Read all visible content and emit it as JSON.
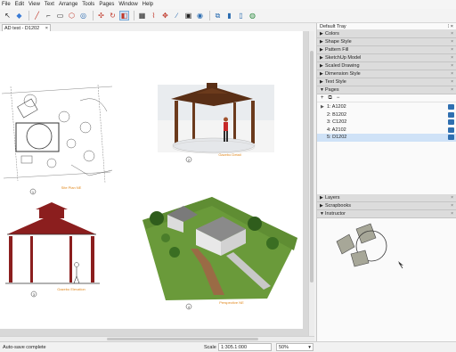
{
  "menu": [
    "File",
    "Edit",
    "View",
    "Text",
    "Arrange",
    "Tools",
    "Pages",
    "Window",
    "Help"
  ],
  "toolbar_icons": [
    "select-icon",
    "eraser-icon",
    "pencil-icon",
    "line-icon",
    "shape-icon",
    "paint-icon",
    "rotate-icon",
    "move-icon",
    "refresh-icon",
    "scrapbook-icon",
    "table-icon",
    "split-icon",
    "join-icon",
    "eyedropper-icon",
    "style-icon",
    "camera-icon",
    "page-add-icon",
    "page-icon",
    "doc-icon",
    "zoom-icon"
  ],
  "document_tab": "AD test - D1202",
  "canvas": {
    "labels": {
      "site_plan": "Site Plan NE",
      "gazebo_view": "Gazebo Detail",
      "elevation": "Gazebo Elevation",
      "perspective": "Perspective NE"
    },
    "numbers": {
      "site_plan": "1",
      "gazebo_view": "2",
      "elevation": "3",
      "perspective": "4"
    }
  },
  "status": {
    "text": "Auto-save complete",
    "scale_label": "Scale",
    "scale_value": "1:305.1:000",
    "zoom": "50%"
  },
  "tray": {
    "title": "Default Tray",
    "panels_top": [
      "Colors",
      "Shape Style",
      "Pattern Fill",
      "SketchUp Model",
      "Scaled Drawing",
      "Dimension Style",
      "Text Style"
    ],
    "pages_panel": "Pages",
    "pages": [
      "1: A1202",
      "2: B1202",
      "3: C1202",
      "4: A2102",
      "5: D1202"
    ],
    "selected_page": 4,
    "panels_bottom": [
      "Layers",
      "Scrapbooks"
    ],
    "instructor_panel": "Instructor"
  }
}
